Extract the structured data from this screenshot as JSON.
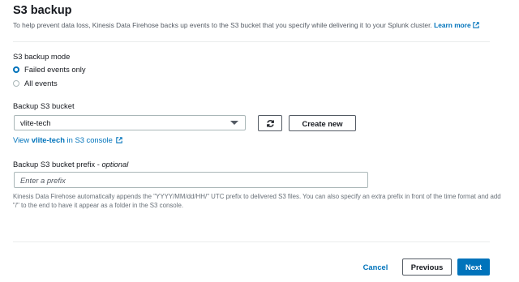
{
  "section": {
    "title": "S3 backup",
    "description": "To help prevent data loss, Kinesis Data Firehose backs up events to the S3 bucket that you specify while delivering it to your Splunk cluster.",
    "learn_more": "Learn more"
  },
  "backup_mode": {
    "label": "S3 backup mode",
    "options": [
      "Failed events only",
      "All events"
    ],
    "selected": "Failed events only"
  },
  "bucket": {
    "label": "Backup S3 bucket",
    "selected_value": "vlite-tech",
    "create_label": "Create new",
    "console_link_prefix": "View",
    "console_link_bucket": "vlite-tech",
    "console_link_suffix": "in S3 console"
  },
  "prefix": {
    "label": "Backup S3 bucket prefix - ",
    "optional_label": "optional",
    "placeholder": "Enter a prefix",
    "hint": "Kinesis Data Firehose automatically appends the \"YYYY/MM/dd/HH/\" UTC prefix to delivered S3 files. You can also specify an extra prefix in front of the time format and add \"/\" to the end to have it appear as a folder in the S3 console."
  },
  "footer": {
    "cancel_label": "Cancel",
    "previous_label": "Previous",
    "next_label": "Next"
  },
  "colors": {
    "link": "#0073bb",
    "primary_button": "#0073bb",
    "text": "#16191f",
    "secondary_text": "#545b64"
  },
  "icons": [
    "external-link-icon",
    "refresh-icon",
    "dropdown-caret-icon"
  ]
}
